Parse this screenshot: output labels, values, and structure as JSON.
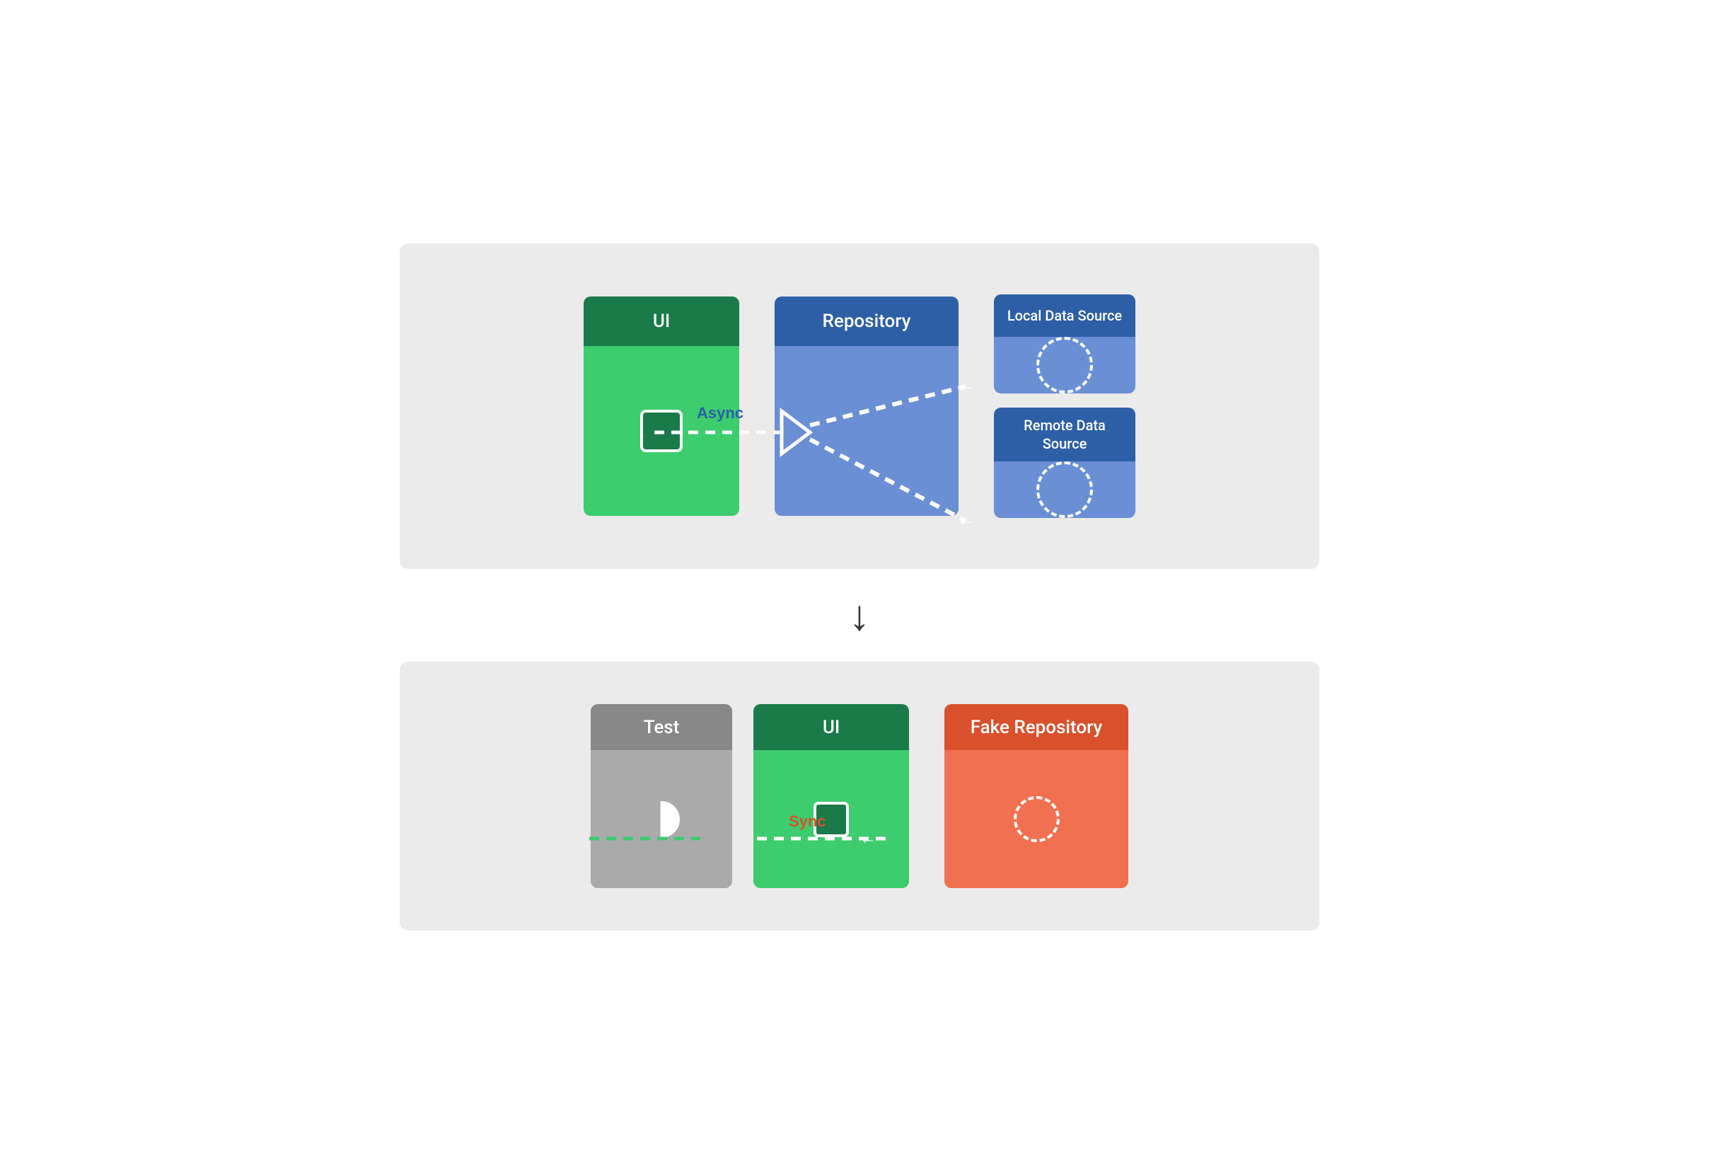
{
  "top_diagram": {
    "ui_label": "UI",
    "repo_label": "Repository",
    "local_source_label": "Local Data Source",
    "remote_source_label": "Remote Data Source",
    "async_label": "Async",
    "colors": {
      "ui_header": "#1a7a4a",
      "ui_body": "#3dcc6e",
      "repo_header": "#2d5fa6",
      "repo_body": "#6b8fd4",
      "datasource_header": "#2d5fa6",
      "datasource_body": "#6b8fd4",
      "bg": "#ebebeb"
    }
  },
  "bottom_diagram": {
    "test_label": "Test",
    "ui_label": "UI",
    "fake_repo_label": "Fake Repository",
    "sync_label": "Sync",
    "colors": {
      "test_header": "#888888",
      "test_body": "#aaaaaa",
      "ui_header": "#1a7a4a",
      "ui_body": "#3dcc6e",
      "fake_repo_header": "#d9512c",
      "fake_repo_body": "#f07050",
      "bg": "#ebebeb"
    }
  },
  "arrow": "↓"
}
